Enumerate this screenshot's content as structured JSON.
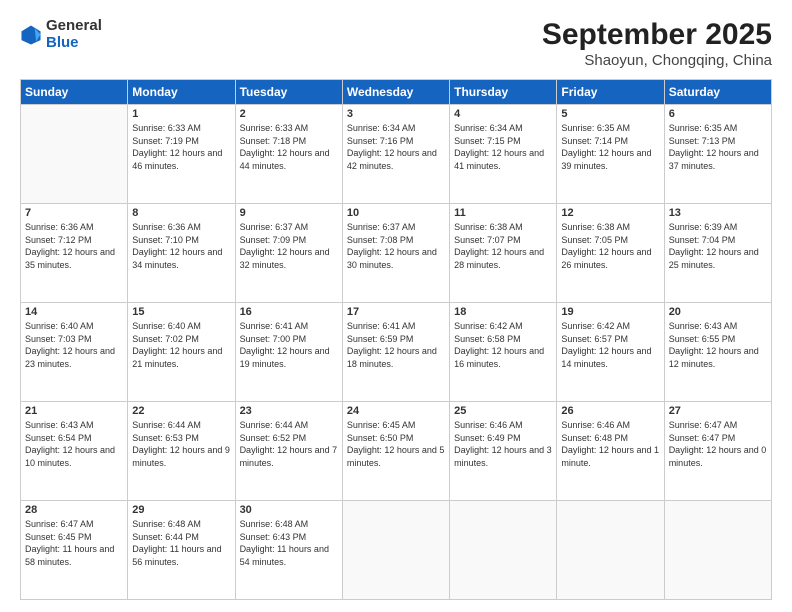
{
  "header": {
    "logo_general": "General",
    "logo_blue": "Blue",
    "month_title": "September 2025",
    "subtitle": "Shaoyun, Chongqing, China"
  },
  "weekdays": [
    "Sunday",
    "Monday",
    "Tuesday",
    "Wednesday",
    "Thursday",
    "Friday",
    "Saturday"
  ],
  "weeks": [
    [
      {
        "day": "",
        "empty": true
      },
      {
        "day": "1",
        "sunrise": "6:33 AM",
        "sunset": "7:19 PM",
        "daylight": "12 hours and 46 minutes."
      },
      {
        "day": "2",
        "sunrise": "6:33 AM",
        "sunset": "7:18 PM",
        "daylight": "12 hours and 44 minutes."
      },
      {
        "day": "3",
        "sunrise": "6:34 AM",
        "sunset": "7:16 PM",
        "daylight": "12 hours and 42 minutes."
      },
      {
        "day": "4",
        "sunrise": "6:34 AM",
        "sunset": "7:15 PM",
        "daylight": "12 hours and 41 minutes."
      },
      {
        "day": "5",
        "sunrise": "6:35 AM",
        "sunset": "7:14 PM",
        "daylight": "12 hours and 39 minutes."
      },
      {
        "day": "6",
        "sunrise": "6:35 AM",
        "sunset": "7:13 PM",
        "daylight": "12 hours and 37 minutes."
      }
    ],
    [
      {
        "day": "7",
        "sunrise": "6:36 AM",
        "sunset": "7:12 PM",
        "daylight": "12 hours and 35 minutes."
      },
      {
        "day": "8",
        "sunrise": "6:36 AM",
        "sunset": "7:10 PM",
        "daylight": "12 hours and 34 minutes."
      },
      {
        "day": "9",
        "sunrise": "6:37 AM",
        "sunset": "7:09 PM",
        "daylight": "12 hours and 32 minutes."
      },
      {
        "day": "10",
        "sunrise": "6:37 AM",
        "sunset": "7:08 PM",
        "daylight": "12 hours and 30 minutes."
      },
      {
        "day": "11",
        "sunrise": "6:38 AM",
        "sunset": "7:07 PM",
        "daylight": "12 hours and 28 minutes."
      },
      {
        "day": "12",
        "sunrise": "6:38 AM",
        "sunset": "7:05 PM",
        "daylight": "12 hours and 26 minutes."
      },
      {
        "day": "13",
        "sunrise": "6:39 AM",
        "sunset": "7:04 PM",
        "daylight": "12 hours and 25 minutes."
      }
    ],
    [
      {
        "day": "14",
        "sunrise": "6:40 AM",
        "sunset": "7:03 PM",
        "daylight": "12 hours and 23 minutes."
      },
      {
        "day": "15",
        "sunrise": "6:40 AM",
        "sunset": "7:02 PM",
        "daylight": "12 hours and 21 minutes."
      },
      {
        "day": "16",
        "sunrise": "6:41 AM",
        "sunset": "7:00 PM",
        "daylight": "12 hours and 19 minutes."
      },
      {
        "day": "17",
        "sunrise": "6:41 AM",
        "sunset": "6:59 PM",
        "daylight": "12 hours and 18 minutes."
      },
      {
        "day": "18",
        "sunrise": "6:42 AM",
        "sunset": "6:58 PM",
        "daylight": "12 hours and 16 minutes."
      },
      {
        "day": "19",
        "sunrise": "6:42 AM",
        "sunset": "6:57 PM",
        "daylight": "12 hours and 14 minutes."
      },
      {
        "day": "20",
        "sunrise": "6:43 AM",
        "sunset": "6:55 PM",
        "daylight": "12 hours and 12 minutes."
      }
    ],
    [
      {
        "day": "21",
        "sunrise": "6:43 AM",
        "sunset": "6:54 PM",
        "daylight": "12 hours and 10 minutes."
      },
      {
        "day": "22",
        "sunrise": "6:44 AM",
        "sunset": "6:53 PM",
        "daylight": "12 hours and 9 minutes."
      },
      {
        "day": "23",
        "sunrise": "6:44 AM",
        "sunset": "6:52 PM",
        "daylight": "12 hours and 7 minutes."
      },
      {
        "day": "24",
        "sunrise": "6:45 AM",
        "sunset": "6:50 PM",
        "daylight": "12 hours and 5 minutes."
      },
      {
        "day": "25",
        "sunrise": "6:46 AM",
        "sunset": "6:49 PM",
        "daylight": "12 hours and 3 minutes."
      },
      {
        "day": "26",
        "sunrise": "6:46 AM",
        "sunset": "6:48 PM",
        "daylight": "12 hours and 1 minute."
      },
      {
        "day": "27",
        "sunrise": "6:47 AM",
        "sunset": "6:47 PM",
        "daylight": "12 hours and 0 minutes."
      }
    ],
    [
      {
        "day": "28",
        "sunrise": "6:47 AM",
        "sunset": "6:45 PM",
        "daylight": "11 hours and 58 minutes."
      },
      {
        "day": "29",
        "sunrise": "6:48 AM",
        "sunset": "6:44 PM",
        "daylight": "11 hours and 56 minutes."
      },
      {
        "day": "30",
        "sunrise": "6:48 AM",
        "sunset": "6:43 PM",
        "daylight": "11 hours and 54 minutes."
      },
      {
        "day": "",
        "empty": true
      },
      {
        "day": "",
        "empty": true
      },
      {
        "day": "",
        "empty": true
      },
      {
        "day": "",
        "empty": true
      }
    ]
  ]
}
